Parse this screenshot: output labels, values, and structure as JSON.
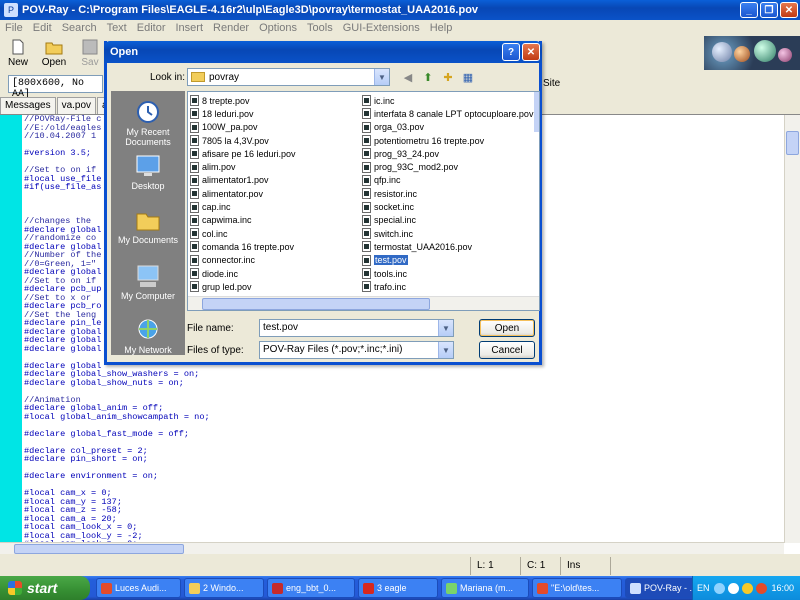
{
  "window": {
    "title": "POV-Ray - C:\\Program Files\\EAGLE-4.16r2\\ulp\\Eagle3D\\povray\\termostat_UAA2016.pov",
    "minimize": "_",
    "maximize": "❐",
    "close": "✕"
  },
  "menu": [
    "File",
    "Edit",
    "Search",
    "Text",
    "Editor",
    "Insert",
    "Render",
    "Options",
    "Tools",
    "GUI-Extensions",
    "Help"
  ],
  "toolbar": {
    "new_label": "New",
    "open_label": "Open",
    "save_label": "Sav"
  },
  "toolbar2": {
    "resolution": "[800x600, No AA]",
    "site_label": "Site"
  },
  "tabs": [
    "Messages",
    "va.pov",
    "alim"
  ],
  "editor": {
    "lines": [
      "//POVRay-File c",
      "//E:/old/eagles",
      "//10.04.2007 1",
      "",
      "#version 3.5;",
      "",
      "//Set to on if",
      "#local use_file",
      "#if(use_file_as",
      "",
      "",
      "",
      "//changes the",
      "#declare global",
      "//randomize co",
      "#declare global",
      "//Number of the",
      "//0=Green, 1=\"",
      "#declare global",
      "//Set to on if",
      "#declare pcb_up",
      "//Set to x or",
      "#declare pcb_ro",
      "//Set the leng",
      "#declare pin_le",
      "#declare global",
      "#declare global",
      "#declare global",
      "",
      "#declare global",
      "#declare global_show_washers = on;",
      "#declare global_show_nuts = on;",
      "",
      "//Animation",
      "#declare global_anim = off;",
      "#local global_anim_showcampath = no;",
      "",
      "#declare global_fast_mode = off;",
      "",
      "#declare col_preset = 2;",
      "#declare pin_short = on;",
      "",
      "#declare environment = on;",
      "",
      "#local cam_x = 0;",
      "#local cam_y = 137;",
      "#local cam_z = -58;",
      "#local cam_a = 20;",
      "#local cam_look_x = 0;",
      "#local cam_look_y = -2;",
      "#local cam_look_z = 0;"
    ]
  },
  "status": {
    "line": "L: 1",
    "col": "C: 1",
    "mode": "Ins"
  },
  "dialog": {
    "title": "Open",
    "help": "?",
    "close": "✕",
    "look_in_label": "Look in:",
    "look_in_value": "povray",
    "places": [
      "My Recent Documents",
      "Desktop",
      "My Documents",
      "My Computer",
      "My Network"
    ],
    "files_col1": [
      "8 trepte.pov",
      "18 leduri.pov",
      "100W_pa.pov",
      "7805 la 4,3V.pov",
      "afisare pe 16 leduri.pov",
      "alim.pov",
      "alimentator1.pov",
      "alimentator.pov",
      "cap.inc",
      "capwima.inc",
      "col.inc",
      "comanda 16 trepte.pov",
      "connector.inc",
      "diode.inc",
      "grup led.pov"
    ],
    "files_col2": [
      "ic.inc",
      "interfata 8 canale LPT optocuploare.pov",
      "orga_03.pov",
      "potentiometru 16 trepte.pov",
      "prog_93_24.pov",
      "prog_93C_mod2.pov",
      "qfp.inc",
      "resistor.inc",
      "socket.inc",
      "special.inc",
      "switch.inc",
      "termostat_UAA2016.pov",
      "test.pov",
      "tools.inc",
      "trafo.inc"
    ],
    "selected_file": "test.pov",
    "file_name_label": "File name:",
    "file_name_value": "test.pov",
    "file_type_label": "Files of type:",
    "file_type_value": "POV-Ray Files (*.pov;*.inc;*.ini)",
    "open_button": "Open",
    "cancel_button": "Cancel"
  },
  "taskbar": {
    "start": "start",
    "tasks": [
      "Luces Audi...",
      "2 Windo...",
      "eng_bbt_0...",
      "3 eagle",
      "Mariana (m...",
      "\"E:\\old\\tes...",
      "POV-Ray - ..."
    ],
    "lang": "EN",
    "clock": "16:00"
  }
}
